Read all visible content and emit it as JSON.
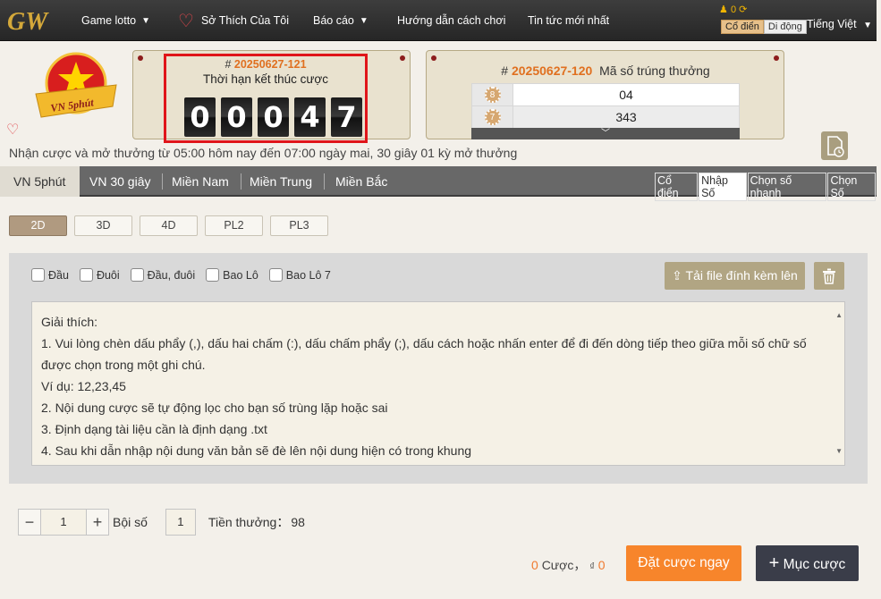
{
  "topbar": {
    "logo_text": "GW",
    "nav": [
      "Game lotto",
      "Sở Thích Của Tôi",
      "Báo cáo",
      "Hướng dẫn cách chơi",
      "Tin tức mới nhất"
    ],
    "balance": "0",
    "mode_classic": "Cổ điển",
    "mode_mobile": "Di động",
    "language": "Tiếng Việt"
  },
  "badge_text": "VN 5phút",
  "timer": {
    "issue": "20250627-121",
    "title": "Thời hạn kết thúc cược",
    "digits": [
      "0",
      "0",
      "0",
      "4",
      "7"
    ]
  },
  "result": {
    "issue": "20250627-120",
    "title": "Mã số trúng thưởng",
    "rows": [
      {
        "prize": "8",
        "value": "04"
      },
      {
        "prize": "7",
        "value": "343"
      }
    ]
  },
  "hint": "Nhận cược và mở thưởng từ 05:00 hôm nay đến 07:00 ngày mai,   30 giây 01 kỳ mở thưởng",
  "tabs": [
    "VN 5phút",
    "VN 30 giây",
    "Miền Nam",
    "Miền Trung",
    "Miền Bắc"
  ],
  "mode_switch": [
    "Cổ điển",
    "Nhập Số",
    "Chọn số nhanh",
    "Chọn Số"
  ],
  "subtabs": [
    "2D",
    "3D",
    "4D",
    "PL2",
    "PL3"
  ],
  "checkboxes": [
    "Đầu",
    "Đuôi",
    "Đầu, đuôi",
    "Bao Lô",
    "Bao Lô 7"
  ],
  "upload_label": "Tải file đính kèm lên",
  "instructions": [
    "Giải thích:",
    "1. Vui lòng chèn dấu phẩy (,), dấu hai chấm (:), dấu chấm phẩy (;), dấu cách hoặc nhấn enter để đi đến dòng tiếp theo giữa mỗi số chữ số",
    "được chọn trong một ghi chú.",
    "Ví dụ: 12,23,45",
    "2. Nội dung cược sẽ tự động lọc cho bạn số trùng lặp hoặc sai",
    "3. Định dạng tài liệu cần là định dạng .txt",
    "4. Sau khi dẫn nhập nội dung văn bản sẽ đè lên nội dung hiện có trong khung"
  ],
  "bet": {
    "quantity": "1",
    "multiplier_label": "Bội số",
    "multiplier_value": "1",
    "prize_label": "Tiền thưởng：",
    "prize_value": "98",
    "count": "0",
    "count_label": "Cược，",
    "amount_symbol": "₫",
    "amount": "0",
    "place_label": "Đặt cược ngay",
    "add_label": "Mục cược"
  }
}
